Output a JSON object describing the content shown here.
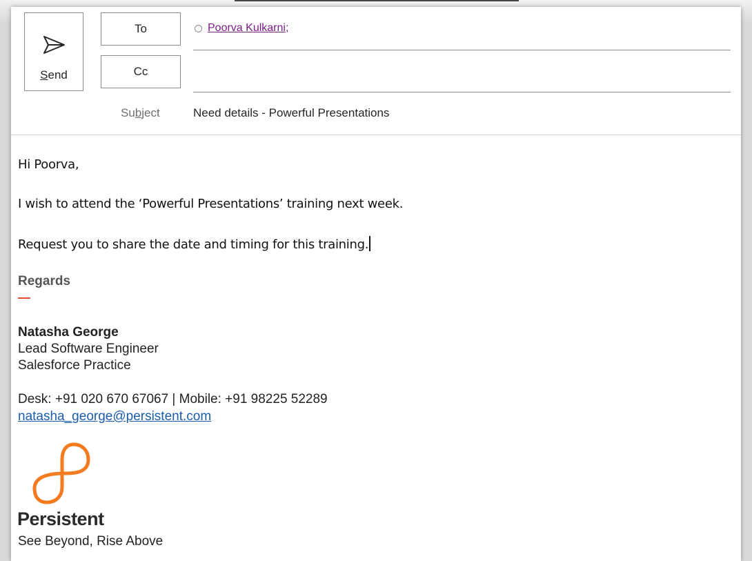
{
  "compose": {
    "send_label": "Send",
    "to_label": "To",
    "cc_label": "Cc",
    "to_recipients": [
      "Poorva Kulkarni;"
    ],
    "cc_value": "",
    "subject_label": "Subject",
    "subject_value": "Need details - Powerful Presentations"
  },
  "message": {
    "greeting": "Hi Poorva,",
    "line1": "I wish to attend the ‘Powerful Presentations’ training next week.",
    "line2": "Request you to share the date and timing for this training."
  },
  "signature": {
    "regards": "Regards",
    "name": "Natasha George",
    "title": "Lead Software Engineer",
    "department": "Salesforce Practice",
    "phones": "Desk: +91 020 670 67067 | Mobile: +91 98225 52289",
    "email": "natasha_george@persistent.com",
    "company": "Persistent",
    "tagline": "See Beyond, Rise Above"
  },
  "icons": {
    "send": "paper-plane-icon",
    "presence": "presence-status-icon",
    "logo": "persistent-logo"
  },
  "colors": {
    "recipient_link": "#7a1e86",
    "email_link": "#1a5ca8",
    "logo_orange": "#f47b20",
    "accent_dash": "#e8452a"
  }
}
